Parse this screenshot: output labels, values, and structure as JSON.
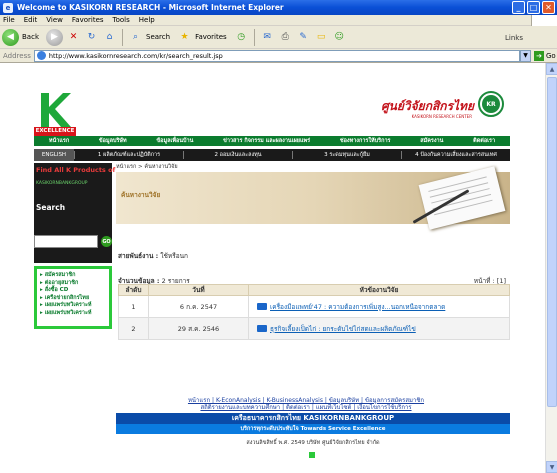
{
  "window": {
    "title": "Welcome to KASIKORN RESEARCH - Microsoft Internet Explorer"
  },
  "menu": [
    "File",
    "Edit",
    "View",
    "Favorites",
    "Tools",
    "Help"
  ],
  "toolbar": {
    "back": "Back",
    "search": "Search",
    "favorites": "Favorites",
    "links": "Links"
  },
  "address": {
    "label": "Address",
    "url": "http://www.kasikornresearch.com/kr/search_result.jsp",
    "go": "Go"
  },
  "site": {
    "excellence": "EXCELLENCE",
    "brand_th": "ศูนย์วิจัยกสิกรไทย",
    "brand_en": "KASIKORN RESEARCH CENTER",
    "brand_logo": "KR",
    "nav1": [
      "หน้าแรก",
      "ข้อมูลบริษัท",
      "ข้อมูลเพื่อนบ้าน",
      "ข่าวสาร กิจกรรม และผลงานเผยแพร่",
      "ช่องทางการให้บริการ",
      "สมัครงาน",
      "ติดต่อเรา"
    ],
    "nav2_eng": "ENGLISH",
    "nav2": [
      "1 ผลิตภัณฑ์และปฏิบัติการ",
      "2 ออมเงินและลงทุน",
      "3 ระดมทุนและกู้ยืม",
      "4 ป้องกันความเสี่ยงและสารสนเทศ"
    ],
    "find_all": "Find All K Products of",
    "find_all_sub": "KASIKORNBANKGROUP",
    "search_label": "Search",
    "search_go": "GO",
    "side_links": [
      "สมัครสมาชิก",
      "ต่ออายุสมาชิก",
      "สั่งซื้อ CD",
      "เครือข่ายกสิกรไทย",
      "เผยแพร่บทวิเคราะห์",
      "เผยแพร่บทวิเคราะห์"
    ],
    "breadcrumb": "หน้าแรก > ค้นหางานวิจัย",
    "banner_title": "ค้นหางานวิจัย",
    "unit_label": "สายพันธ์งาน :",
    "unit_value": "ใช้หรือนก",
    "count_label": "จำนวนข้อมูล :",
    "count_value": "2 รายการ",
    "page_label": "หน้าที่ : [1]",
    "table": {
      "headers": [
        "ลำดับ",
        "วันที่",
        "หัวข้องานวิจัย"
      ],
      "rows": [
        {
          "no": "1",
          "date": "6 ก.ค. 2547",
          "title": "เครื่องมือแพทย์'47 : ความต้องการเพิ่มสูง...นอกเหนือจากตลาด"
        },
        {
          "no": "2",
          "date": "29 ส.ค. 2546",
          "title": "ธุรกิจเลี้ยงเป็ดไก่ : ยกระดับไข่ไก่สดและผลิตภัณฑ์ไข่"
        }
      ]
    },
    "footer_links_1": "หน้าแรก | K-EconAnalysis | K-BusinessAnalysis | ข้อมูลบริษัท | ข้อมูลการสมัครสมาชิก",
    "footer_links_2": "สถิติรายงานและบทความศึกษา | ติดต่อเรา | แผนที่เว็บไซต์ | เงื่อนไขการใช้บริการ",
    "footer_bar1": "เครือธนาคารกสิกรไทย KASIKORNBANKGROUP",
    "footer_bar2": "บริการทุกระดับประทับใจ Towards Service Excellence",
    "copyright": "สงวนลิขสิทธิ์ พ.ศ. 2549 บริษัท ศูนย์วิจัยกสิกรไทย จำกัด"
  }
}
